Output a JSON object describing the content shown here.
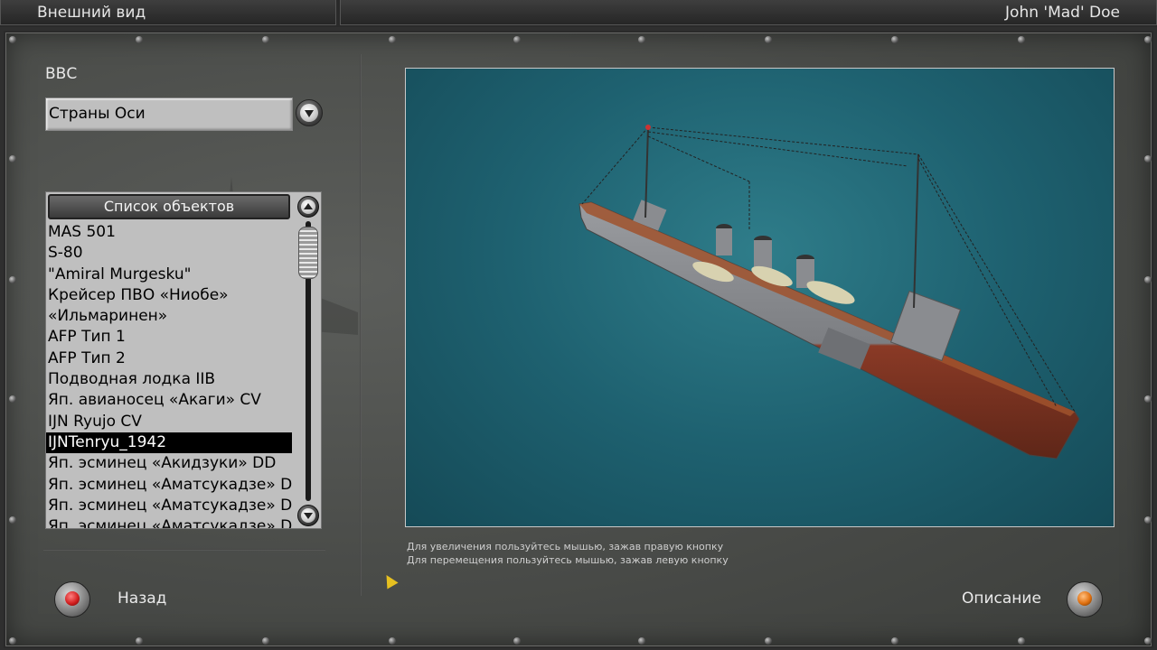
{
  "topbar": {
    "title": "Внешний вид",
    "user": "John 'Mad' Doe"
  },
  "filter": {
    "label": "ВВС",
    "selected": "Страны Оси"
  },
  "objects": {
    "header": "Список объектов",
    "items": [
      "MAS 501",
      "S-80",
      "\"Amiral Murgesku\"",
      "Крейсер ПВО «Ниобе»",
      "«Ильмаринен»",
      "AFP Тип 1",
      "AFP Тип 2",
      "Подводная лодка  IIB",
      "Яп. авианосец «Акаги» CV",
      "IJN Ryujo CV",
      "IJNTenryu_1942",
      "Яп. эсминец «Акидзуки» DD",
      "Яп. эсминец «Аматсукадзе» DD",
      "Яп. эсминец «Аматсукадзе» DD",
      "Яп. эсминец «Аматсукадзе» DD"
    ],
    "selected_index": 10
  },
  "hints": {
    "zoom": "Для увеличения пользуйтесь мышью, зажав правую кнопку",
    "move": "Для перемещения пользуйтесь мышью, зажав левую кнопку"
  },
  "buttons": {
    "back": "Назад",
    "description": "Описание"
  },
  "colors": {
    "back_lamp": "#d42020",
    "description_lamp": "#e07010",
    "selection": "#000000",
    "sea": "#1e6170"
  }
}
